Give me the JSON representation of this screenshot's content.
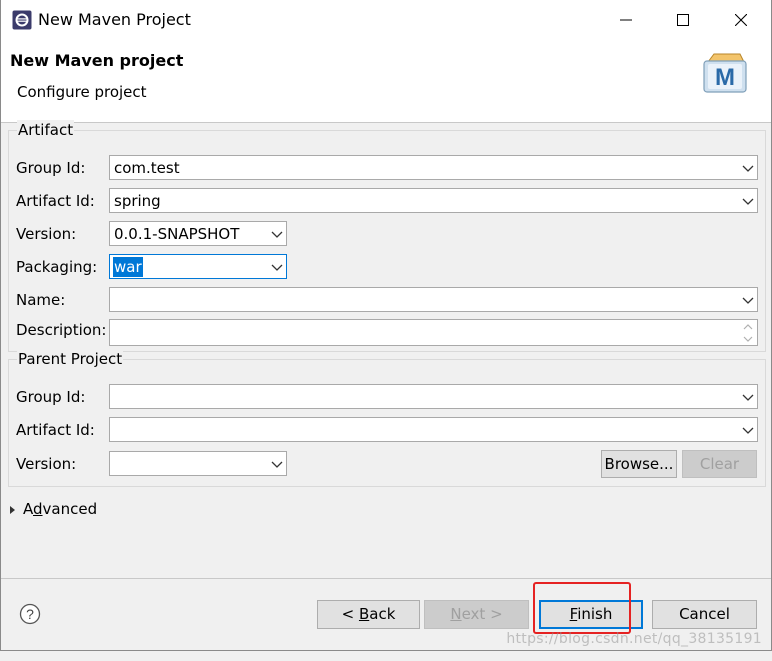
{
  "window": {
    "title": "New Maven Project",
    "controls": [
      "minimize",
      "maximize",
      "close"
    ]
  },
  "header": {
    "title": "New Maven project",
    "subtitle": "Configure project",
    "logo_letter": "M"
  },
  "artifact": {
    "group_title": "Artifact",
    "group_id": {
      "label": "Group Id:",
      "value": "com.test"
    },
    "artifact_id": {
      "label": "Artifact Id:",
      "value": "spring"
    },
    "version": {
      "label": "Version:",
      "value": "0.0.1-SNAPSHOT"
    },
    "packaging": {
      "label": "Packaging:",
      "value": "war"
    },
    "name": {
      "label": "Name:",
      "value": ""
    },
    "description": {
      "label": "Description:",
      "value": ""
    }
  },
  "parent": {
    "group_title": "Parent Project",
    "group_id": {
      "label": "Group Id:",
      "value": ""
    },
    "artifact_id": {
      "label": "Artifact Id:",
      "value": ""
    },
    "version": {
      "label": "Version:",
      "value": ""
    },
    "browse_label": "Browse...",
    "clear_label": "Clear"
  },
  "advanced": {
    "label_pre": "A",
    "label_mnemonic": "d",
    "label_post": "vanced",
    "expanded": false
  },
  "footer": {
    "help_symbol": "?",
    "back": {
      "arrow": "< ",
      "mnemonic": "B",
      "rest": "ack"
    },
    "next": {
      "mnemonic": "N",
      "rest": "ext >"
    },
    "finish": {
      "mnemonic": "F",
      "rest": "inish"
    },
    "cancel": "Cancel"
  },
  "watermark": "https://blog.csdn.net/qq_38135191",
  "colors": {
    "accent": "#0078d7",
    "highlight_box": "#e52222"
  }
}
